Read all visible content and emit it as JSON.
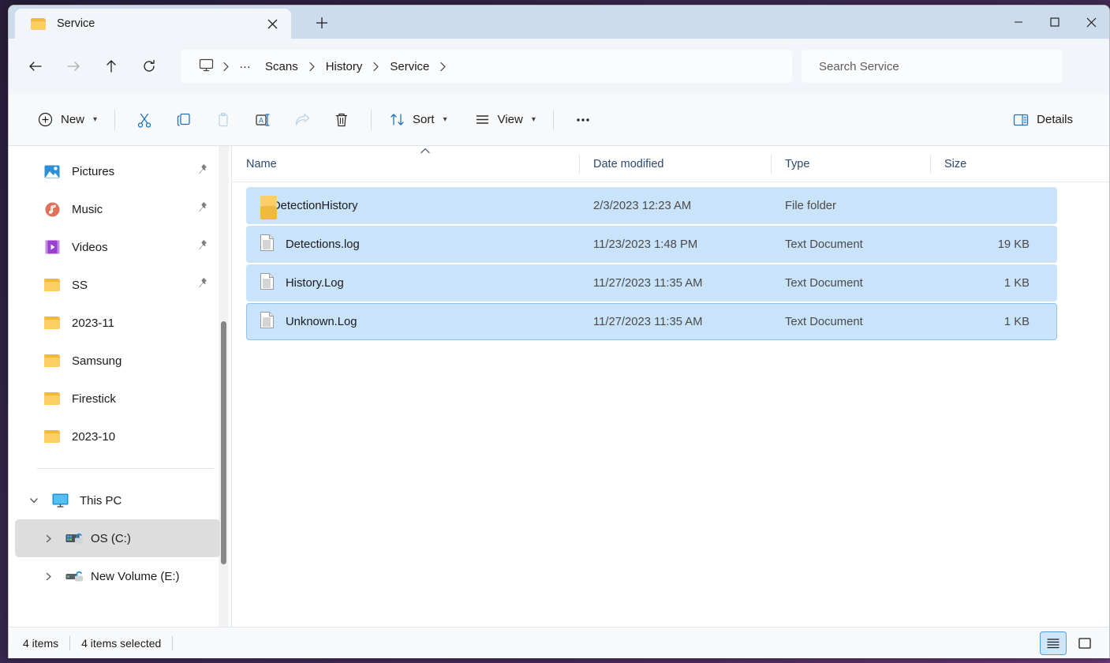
{
  "window": {
    "titlebar_color": "#ccdced",
    "selection_color": "#c9e3fb",
    "minimize_label": "Minimize",
    "maximize_label": "Maximize",
    "close_label": "Close"
  },
  "tabs": [
    {
      "label": "Service",
      "icon": "folder-icon",
      "close_label": "Close tab",
      "active": true
    }
  ],
  "new_tab_label": "+",
  "nav": {
    "back_label": "Back",
    "forward_label": "Forward",
    "up_label": "Up to parent",
    "refresh_label": "Refresh",
    "breadcrumb": {
      "root_icon": "monitor-icon",
      "ellipsis": "…",
      "items": [
        "Scans",
        "History",
        "Service"
      ]
    },
    "search": {
      "placeholder": "Search Service",
      "value": ""
    }
  },
  "toolbar": {
    "new_label": "New",
    "cut_label": "Cut",
    "copy_label": "Copy",
    "paste_label": "Paste",
    "rename_label": "Rename",
    "share_label": "Share",
    "delete_label": "Delete",
    "sort_label": "Sort",
    "view_label": "View",
    "more_label": "See more",
    "details_label": "Details"
  },
  "sidebar": {
    "items": [
      {
        "label": "Pictures",
        "icon": "pictures-icon",
        "pinned": true,
        "expander": false,
        "indent": 0
      },
      {
        "label": "Music",
        "icon": "music-icon",
        "pinned": true,
        "expander": false,
        "indent": 0
      },
      {
        "label": "Videos",
        "icon": "videos-icon",
        "pinned": true,
        "expander": false,
        "indent": 0
      },
      {
        "label": "SS",
        "icon": "folder-icon",
        "pinned": true,
        "expander": false,
        "indent": 0
      },
      {
        "label": "2023-11",
        "icon": "folder-icon",
        "pinned": false,
        "expander": false,
        "indent": 0
      },
      {
        "label": "Samsung",
        "icon": "folder-icon",
        "pinned": false,
        "expander": false,
        "indent": 0
      },
      {
        "label": "Firestick",
        "icon": "folder-icon",
        "pinned": false,
        "expander": false,
        "indent": 0
      },
      {
        "label": "2023-10",
        "icon": "folder-icon",
        "pinned": false,
        "expander": false,
        "indent": 0
      }
    ],
    "tree": [
      {
        "label": "This PC",
        "icon": "pc-icon",
        "expander": "down",
        "expanded": true,
        "hovered": false,
        "indent": 0
      },
      {
        "label": "OS (C:)",
        "icon": "drive-os-icon",
        "expander": "right",
        "expanded": false,
        "hovered": true,
        "indent": 1
      },
      {
        "label": "New Volume (E:)",
        "icon": "drive-icon",
        "expander": "right",
        "expanded": false,
        "hovered": false,
        "indent": 1
      }
    ]
  },
  "filelist": {
    "columns": [
      {
        "key": "name",
        "label": "Name",
        "sorted": "asc"
      },
      {
        "key": "date",
        "label": "Date modified",
        "sorted": null
      },
      {
        "key": "type",
        "label": "Type",
        "sorted": null
      },
      {
        "key": "size",
        "label": "Size",
        "sorted": null
      }
    ],
    "rows": [
      {
        "name": "DetectionHistory",
        "date": "2/3/2023 12:23 AM",
        "type": "File folder",
        "size": "",
        "icon": "folder-icon",
        "selected": true,
        "focused": false
      },
      {
        "name": "Detections.log",
        "date": "11/23/2023 1:48 PM",
        "type": "Text Document",
        "size": "19 KB",
        "icon": "document-icon",
        "selected": true,
        "focused": false
      },
      {
        "name": "History.Log",
        "date": "11/27/2023 11:35 AM",
        "type": "Text Document",
        "size": "1 KB",
        "icon": "document-icon",
        "selected": true,
        "focused": false
      },
      {
        "name": "Unknown.Log",
        "date": "11/27/2023 11:35 AM",
        "type": "Text Document",
        "size": "1 KB",
        "icon": "document-icon",
        "selected": true,
        "focused": true
      }
    ]
  },
  "statusbar": {
    "item_count": "4 items",
    "selection_count": "4 items selected",
    "details_view_label": "Details view",
    "large_icons_view_label": "Large icons view",
    "active_view": "details"
  }
}
